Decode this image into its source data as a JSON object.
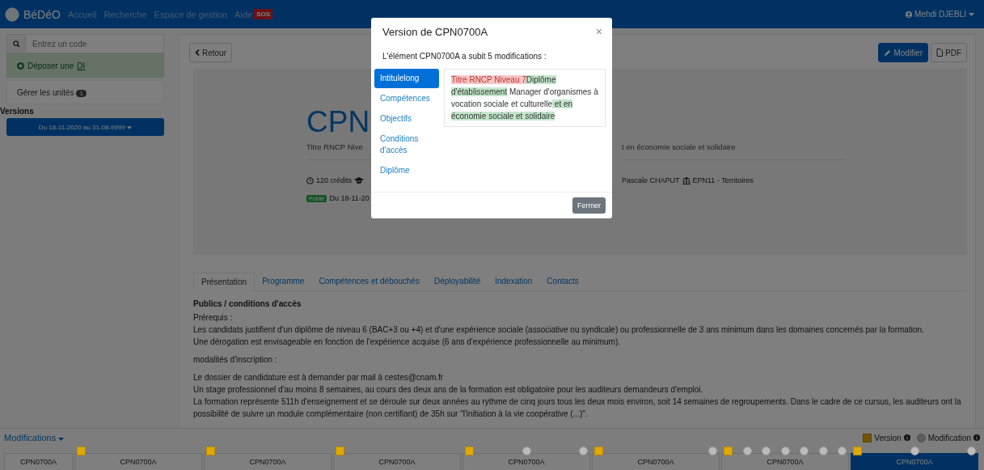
{
  "navbar": {
    "brand": "BéDéO",
    "links": [
      "Accueil",
      "Recherche",
      "Espace de gestion",
      "Aide"
    ],
    "sos_badge": "SOS",
    "user": "Mehdi DJEBLI"
  },
  "sidebar": {
    "search": {
      "placeholder": "Entrez un code"
    },
    "deposit": {
      "label": "Déposer une",
      "link": "DI"
    },
    "manage": {
      "label": "Gérer les unités",
      "count": "1"
    },
    "versions_heading": "Versions",
    "version_select": "Du 18-11-2020 au 31-08-9999"
  },
  "toolbar": {
    "back": "Retour",
    "edit": "Modifier",
    "pdf": "PDF"
  },
  "hero": {
    "title": "CPN",
    "subtitle_left": "Titre RNCP Nive",
    "subtitle_right": "t en économie sociale et solidaire",
    "credits": "120 crédits",
    "manager": "Pascale CHAPUT",
    "center": "EPN11 - Territoires",
    "status": "Publié",
    "date": "Du 18-11-20"
  },
  "tabs": [
    {
      "label": "Présentation",
      "selected": true
    },
    {
      "label": "Programme",
      "selected": false
    },
    {
      "label": "Compétences et débouchés",
      "selected": false
    },
    {
      "label": "Déployabilité",
      "selected": false
    },
    {
      "label": "Indexation",
      "selected": false
    },
    {
      "label": "Contacts",
      "selected": false
    }
  ],
  "content": {
    "heading": "Publics / conditions d'accès",
    "paragraphs": [
      {
        "lines": [
          "Prérequis :",
          "Les candidats justifient d'un diplôme de niveau 6 (BAC+3 ou +4) et d'une expérience sociale (associative ou syndicale) ou professionnelle de 3 ans minimum dans les domaines concernés par la formation.",
          "Une dérogation est envisageable en fonction de l'expérience acquise (6 ans d'expérience professionnelle au minimum)."
        ]
      },
      {
        "lines": [
          "modalités d'inscription :"
        ]
      },
      {
        "lines": [
          "Le dossier de candidature est à demander par mail à cestes@cnam.fr",
          "Un stage professionnel d'au moins 8 semaines, au cours des deux ans de la formation est obligatoire pour les auditeurs demandeurs d'emploi.",
          "La formation représente 511h d'enseignement et se déroule sur deux années au rythme de cinq jours tous les deux mois environ, soit 14 semaines de regroupements. Dans le cadre de ce cursus, les auditeurs ont la possibilité de suivre un module complémentaire (non certifiant) de 35h sur \"l'initiation à la vie coopérative (...)\"."
        ]
      }
    ]
  },
  "timeline": {
    "title": "Modifications",
    "legend": [
      {
        "kind": "version",
        "label": "Version"
      },
      {
        "kind": "modification",
        "label": "Modification"
      }
    ],
    "segments": [
      {
        "label": "CPN0700A",
        "selected": false
      },
      {
        "label": "CPN0700A",
        "selected": false,
        "markers": [
          {
            "kind": "version"
          }
        ]
      },
      {
        "label": "CPN0700A",
        "selected": false,
        "markers": [
          {
            "kind": "version"
          }
        ]
      },
      {
        "label": "CPN0700A",
        "selected": false,
        "markers": [
          {
            "kind": "version"
          }
        ]
      },
      {
        "label": "CPN0700A",
        "selected": false,
        "markers": [
          {
            "kind": "version"
          },
          {
            "kind": "modification"
          },
          {
            "kind": "modification"
          }
        ]
      },
      {
        "label": "CPN0700A",
        "selected": false,
        "markers": [
          {
            "kind": "version"
          },
          {
            "kind": "modification"
          }
        ]
      },
      {
        "label": "CPN0700A",
        "selected": false,
        "markers": [
          {
            "kind": "version"
          },
          {
            "kind": "modification"
          },
          {
            "kind": "modification"
          },
          {
            "kind": "modification"
          },
          {
            "kind": "modification"
          },
          {
            "kind": "modification"
          },
          {
            "kind": "modification"
          }
        ]
      },
      {
        "label": "CPN0700A",
        "selected": true,
        "markers": [
          {
            "kind": "version"
          },
          {
            "kind": "modification"
          },
          {
            "kind": "modification"
          }
        ]
      }
    ]
  },
  "modal": {
    "title": "Version de CPN0700A",
    "close": "×",
    "message": "L'élément CPN0700A a subit 5 modifications :",
    "fields": [
      {
        "label": "Intitulelong",
        "selected": true
      },
      {
        "label": "Compétences",
        "selected": false
      },
      {
        "label": "Objectifs",
        "selected": false
      },
      {
        "label": "Conditions d'accès",
        "selected": false
      },
      {
        "label": "Diplôme",
        "selected": false
      }
    ],
    "diff": [
      {
        "text": "Titre RNCP Niveau 7",
        "kind": "removed"
      },
      {
        "text": "Diplôme d'établissement",
        "kind": "added"
      },
      {
        "text": " Manager d'organismes à vocation sociale et culturelle",
        "kind": "unchanged"
      },
      {
        "text": " et en économie sociale et solidaire",
        "kind": "added"
      }
    ],
    "close_button": "Fermer"
  }
}
